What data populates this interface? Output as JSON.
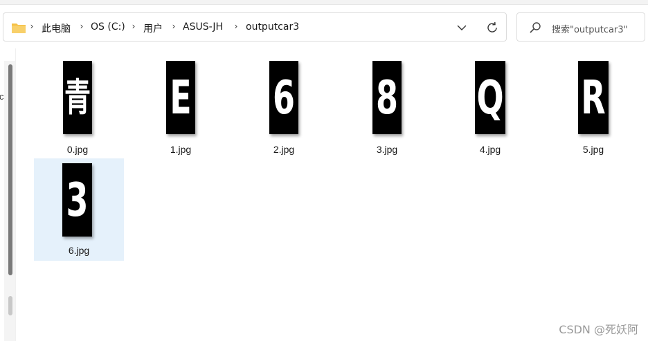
{
  "breadcrumb": [
    {
      "label": "此电脑"
    },
    {
      "label": "OS (C:)"
    },
    {
      "label": "用户"
    },
    {
      "label": "ASUS-JH"
    },
    {
      "label": "outputcar3"
    }
  ],
  "search": {
    "placeholder": "搜索\"outputcar3\""
  },
  "nav": {
    "edge_text": "c"
  },
  "files": [
    {
      "name": "0.jpg",
      "glyph": "青"
    },
    {
      "name": "1.jpg",
      "glyph": "E"
    },
    {
      "name": "2.jpg",
      "glyph": "6"
    },
    {
      "name": "3.jpg",
      "glyph": "8"
    },
    {
      "name": "4.jpg",
      "glyph": "Q"
    },
    {
      "name": "5.jpg",
      "glyph": "R"
    },
    {
      "name": "6.jpg",
      "glyph": "3",
      "selected": true
    }
  ],
  "watermark": "CSDN @死妖阿",
  "colors": {
    "selection": "#e5f1fb",
    "folder": "#f5c044"
  }
}
